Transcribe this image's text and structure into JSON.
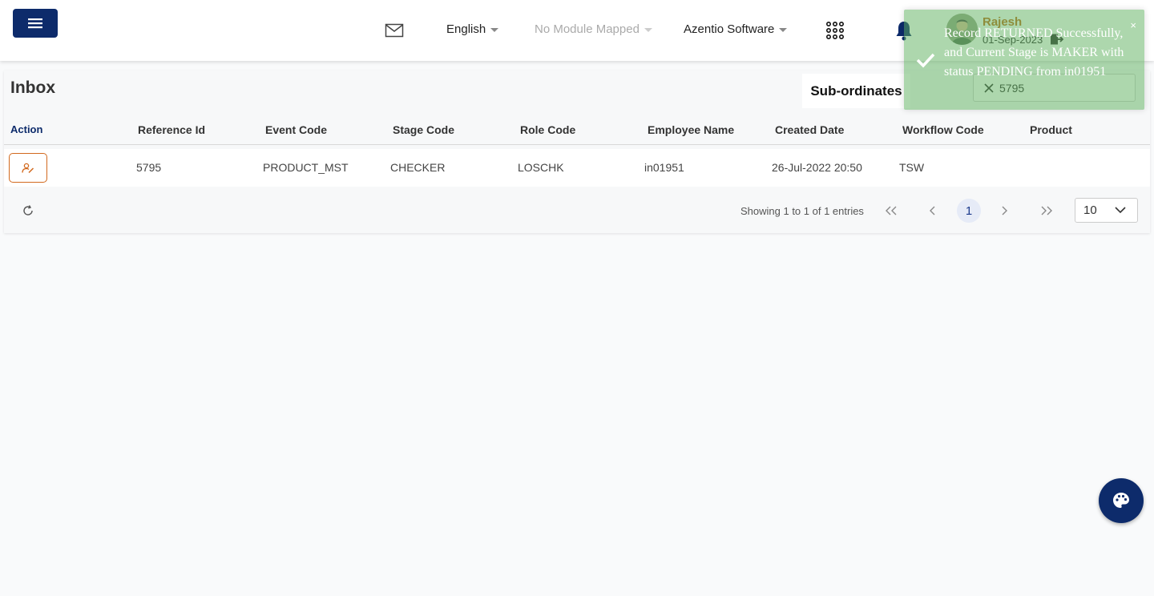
{
  "header": {
    "language": "English",
    "module": "No Module Mapped",
    "company": "Azentio Software",
    "user": {
      "name": "Rajesh",
      "date": "01-Sep-2023"
    },
    "icons": [
      "menu-icon",
      "mail-icon",
      "apps-grid-icon",
      "bell-icon",
      "logout-icon"
    ]
  },
  "inbox": {
    "title": "Inbox",
    "tab": "Sub-ordinates",
    "search_value": "5795",
    "columns": [
      "Action",
      "Reference Id",
      "Event Code",
      "Stage Code",
      "Role Code",
      "Employee Name",
      "Created Date",
      "Workflow Code",
      "Product"
    ],
    "rows": [
      {
        "reference_id": "5795",
        "event_code": "PRODUCT_MST",
        "stage_code": "CHECKER",
        "role_code": "LOSCHK",
        "employee_name": "in01951",
        "created_date": "26-Jul-2022 20:50",
        "workflow_code": "TSW",
        "product": ""
      }
    ],
    "pagination": {
      "showing": "Showing 1 to 1 of 1 entries",
      "current_page": "1",
      "page_size": "10"
    }
  },
  "toast": {
    "message": "Record RETURNED Successfully, and Current Stage is MAKER with status PENDING from in01951",
    "close": "×"
  },
  "colors": {
    "primary": "#0d2b6b",
    "accent": "#d2691e",
    "toast_bg": "#5caf5c"
  }
}
